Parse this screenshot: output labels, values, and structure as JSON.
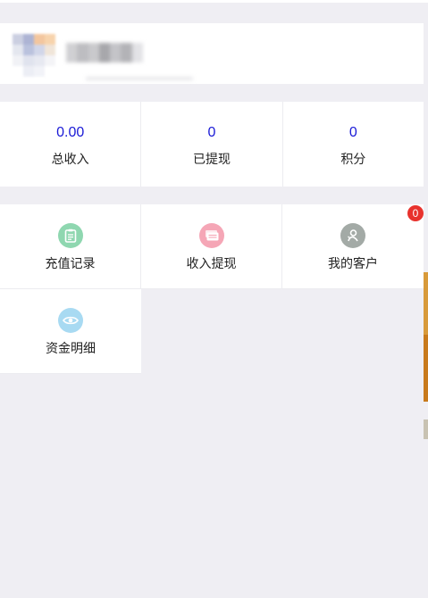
{
  "stats": [
    {
      "value": "0.00",
      "label": "总收入"
    },
    {
      "value": "0",
      "label": "已提现"
    },
    {
      "value": "0",
      "label": "积分"
    }
  ],
  "menu": {
    "items": [
      {
        "label": "充值记录",
        "icon": "clipboard-icon",
        "color": "#8fd7b0"
      },
      {
        "label": "收入提现",
        "icon": "cash-stack-icon",
        "color": "#f5a6b6"
      },
      {
        "label": "我的客户",
        "icon": "customer-icon",
        "color": "#a3aaa6",
        "badge": "0"
      },
      {
        "label": "资金明细",
        "icon": "eye-icon",
        "color": "#a8daf2"
      }
    ]
  },
  "colors": {
    "background": "#efeef3",
    "stat_value": "#1a1ad6",
    "badge": "#e8322d"
  }
}
